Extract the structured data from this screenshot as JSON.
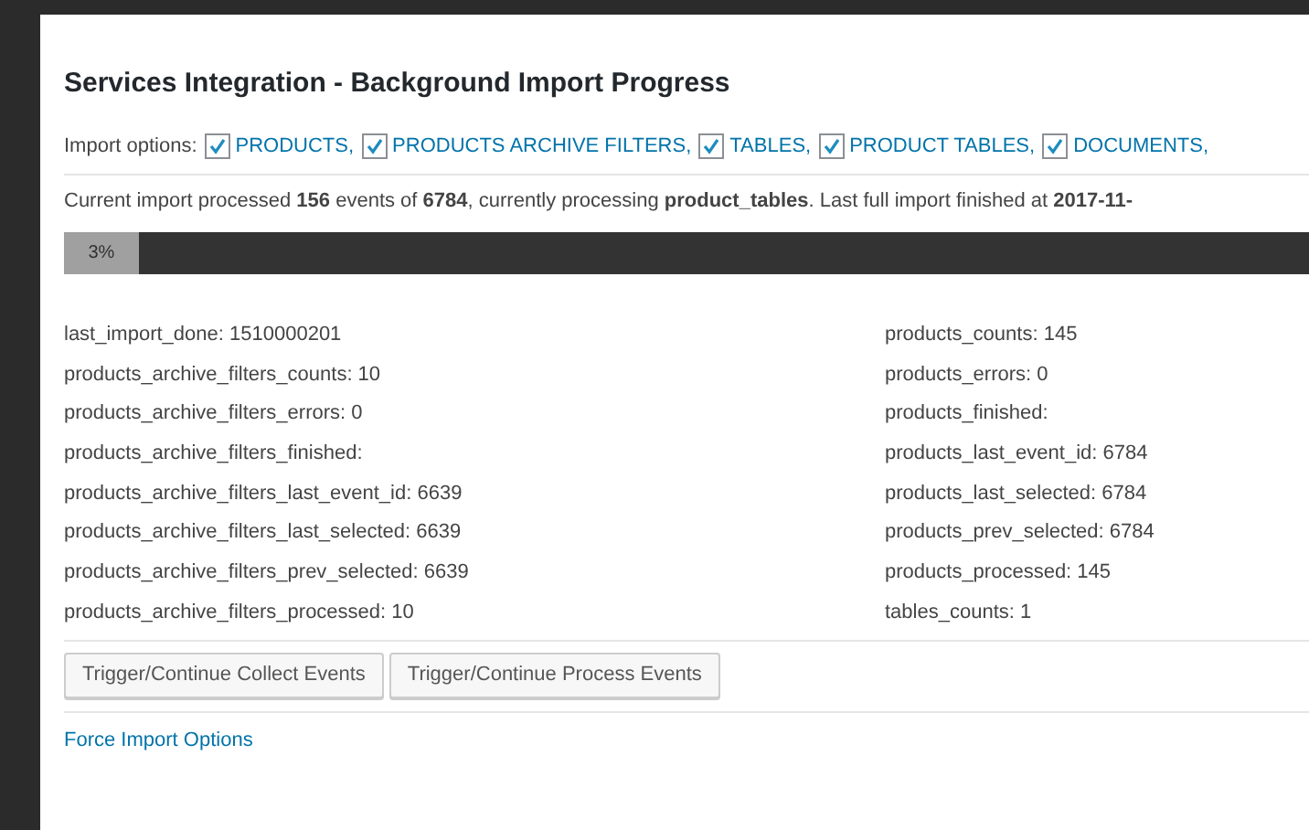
{
  "title": "Services Integration - Background Import Progress",
  "import_options": {
    "label": "Import options:",
    "options": [
      {
        "label": "PRODUCTS,",
        "checked": true
      },
      {
        "label": "PRODUCTS ARCHIVE FILTERS,",
        "checked": true
      },
      {
        "label": "TABLES,",
        "checked": true
      },
      {
        "label": "PRODUCT TABLES,",
        "checked": true
      },
      {
        "label": "DOCUMENTS,",
        "checked": true
      }
    ]
  },
  "status": "Current import processed **156** events of **6784**, currently processing **product_tables**. Last full import finished at **2017-11-**",
  "progress": {
    "label": "3%",
    "level": 0.03
  },
  "stats_left": [
    "last_import_done: 1510000201",
    "products_archive_filters_counts: 10",
    "products_archive_filters_errors: 0",
    "products_archive_filters_finished:",
    "products_archive_filters_last_event_id: 6639",
    "products_archive_filters_last_selected: 6639",
    "products_archive_filters_prev_selected: 6639",
    "products_archive_filters_processed: 10"
  ],
  "stats_right": [
    "products_counts: 145",
    "products_errors: 0",
    "products_finished:",
    "products_last_event_id: 6784",
    "products_last_selected: 6784",
    "products_prev_selected: 6784",
    "products_processed: 145",
    "tables_counts: 1"
  ],
  "buttons": [
    "Trigger/Continue Collect Events",
    "Trigger/Continue Process Events"
  ],
  "link": "Force Import Options"
}
